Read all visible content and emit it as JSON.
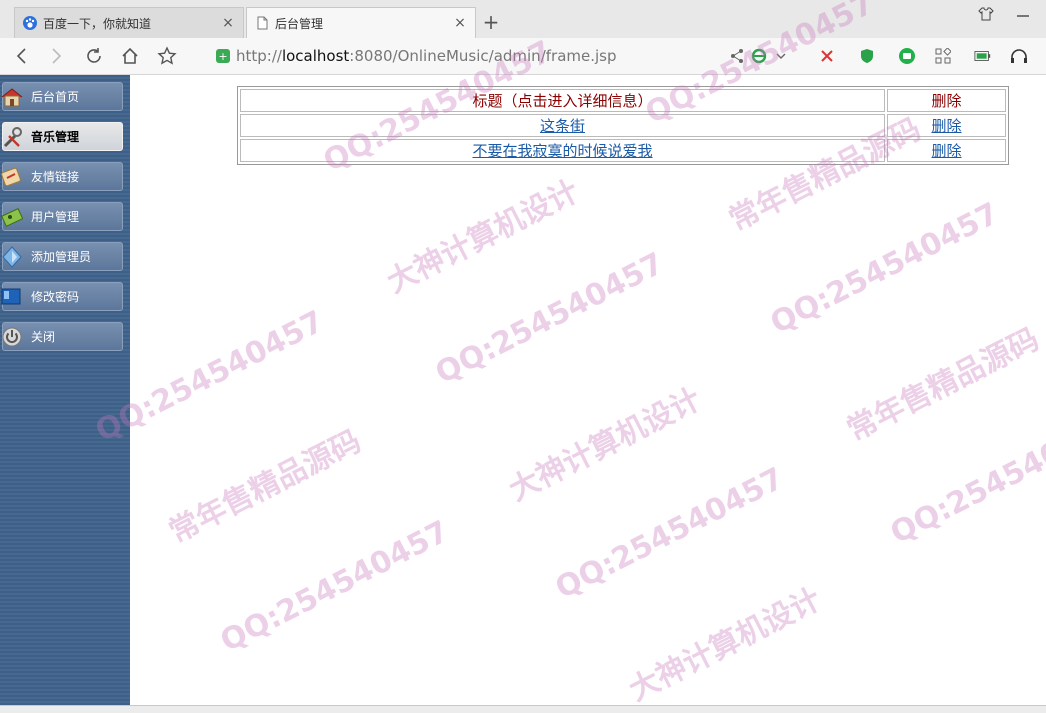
{
  "browser": {
    "tabs": [
      {
        "label": "百度一下，你就知道",
        "close": "×",
        "icon": "baidu-paw-icon"
      },
      {
        "label": "后台管理",
        "close": "×",
        "icon": "page-icon"
      }
    ],
    "new_tab": "+",
    "url_scheme": "http://",
    "url_host": "localhost",
    "url_path": ":8080/OnlineMusic/admin/frame.jsp"
  },
  "sidebar": {
    "items": [
      {
        "label": "后台首页",
        "icon": "house-icon",
        "active": false
      },
      {
        "label": "音乐管理",
        "icon": "wrench-icon",
        "active": true
      },
      {
        "label": "友情链接",
        "icon": "link-icon",
        "active": false
      },
      {
        "label": "用户管理",
        "icon": "user-card-icon",
        "active": false
      },
      {
        "label": "添加管理员",
        "icon": "add-admin-icon",
        "active": false
      },
      {
        "label": "修改密码",
        "icon": "password-icon",
        "active": false
      },
      {
        "label": "关闭",
        "icon": "power-icon",
        "active": false
      }
    ]
  },
  "table": {
    "header": {
      "title": "标题（点击进入详细信息）",
      "action": "删除"
    },
    "rows": [
      {
        "title": "这条街",
        "action": "删除"
      },
      {
        "title": "不要在我寂寞的时候说爱我",
        "action": "删除"
      }
    ]
  },
  "watermark": {
    "lines": [
      "QQ:254540457",
      "常年售精品源码",
      "大神计算机设计"
    ],
    "color": "#c878be"
  },
  "colors": {
    "sidebar_bg": "#3e5f87",
    "header_text": "#8b0000",
    "link": "#1a5aa6"
  }
}
